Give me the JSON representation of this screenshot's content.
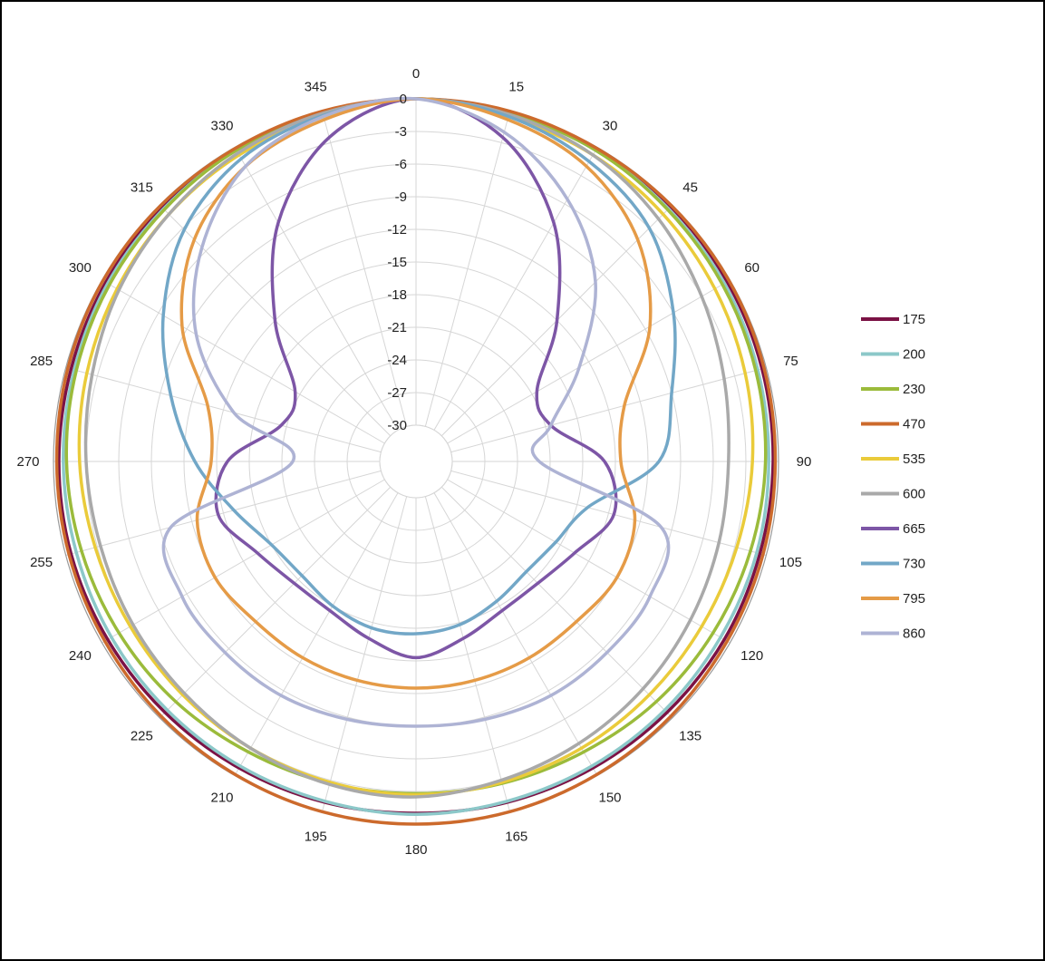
{
  "chart_data": {
    "type": "line",
    "subtype": "polar",
    "title": "",
    "angular_axis": {
      "unit": "degrees",
      "direction": "clockwise",
      "zero_at": "top",
      "tick_labels": [
        "0",
        "15",
        "30",
        "45",
        "60",
        "75",
        "90",
        "105",
        "120",
        "135",
        "150",
        "165",
        "180",
        "195",
        "210",
        "225",
        "240",
        "255",
        "270",
        "285",
        "300",
        "315",
        "330",
        "345"
      ]
    },
    "radial_axis": {
      "range": [
        -30,
        0
      ],
      "tick_labels": [
        "0",
        "-3",
        "-6",
        "-9",
        "-12",
        "-15",
        "-18",
        "-21",
        "-24",
        "-27",
        "-30"
      ]
    },
    "grid": true,
    "legend_position": "right",
    "angles": [
      0,
      15,
      30,
      45,
      60,
      75,
      90,
      105,
      120,
      135,
      150,
      165,
      180,
      195,
      210,
      225,
      240,
      255,
      270,
      285,
      300,
      315,
      330,
      345
    ],
    "series": [
      {
        "name": "175",
        "color": "#7B1245",
        "values": [
          0,
          -0.1,
          -0.1,
          -0.2,
          -0.3,
          -0.4,
          -0.5,
          -0.6,
          -0.6,
          -0.7,
          -0.8,
          -0.9,
          -1.0,
          -0.9,
          -0.8,
          -0.7,
          -0.6,
          -0.5,
          -0.5,
          -0.5,
          -0.4,
          -0.3,
          -0.2,
          -0.1
        ]
      },
      {
        "name": "200",
        "color": "#8CC8C9",
        "values": [
          0,
          -0.2,
          -0.3,
          -0.5,
          -0.6,
          -0.8,
          -0.9,
          -0.9,
          -1.0,
          -1.0,
          -1.0,
          -1.0,
          -0.9,
          -1.0,
          -1.0,
          -1.0,
          -1.0,
          -1.0,
          -0.9,
          -0.8,
          -0.6,
          -0.5,
          -0.3,
          -0.2
        ]
      },
      {
        "name": "230",
        "color": "#9BBB3B",
        "values": [
          0,
          -0.2,
          -0.3,
          -0.6,
          -0.8,
          -1.0,
          -1.2,
          -1.5,
          -1.8,
          -2.1,
          -2.5,
          -2.7,
          -2.8,
          -2.7,
          -2.5,
          -2.1,
          -1.8,
          -1.5,
          -1.2,
          -1.0,
          -0.8,
          -0.6,
          -0.3,
          -0.2
        ]
      },
      {
        "name": "470",
        "color": "#CC6A2C",
        "values": [
          0,
          0,
          -0.1,
          -0.1,
          -0.1,
          -0.2,
          -0.3,
          -0.3,
          -0.3,
          -0.2,
          -0.1,
          0,
          0,
          0,
          -0.1,
          -0.2,
          -0.3,
          -0.3,
          -0.3,
          -0.2,
          -0.1,
          -0.1,
          -0.1,
          0
        ]
      },
      {
        "name": "535",
        "color": "#EACB3A",
        "values": [
          0,
          -0.5,
          -0.8,
          -1.2,
          -1.6,
          -2.0,
          -2.4,
          -2.8,
          -3.0,
          -3.0,
          -2.9,
          -2.8,
          -2.7,
          -2.8,
          -2.9,
          -3.0,
          -3.0,
          -2.8,
          -2.4,
          -2.0,
          -1.6,
          -1.2,
          -0.8,
          -0.5
        ]
      },
      {
        "name": "600",
        "color": "#A9A9A9",
        "values": [
          0,
          -0.3,
          -0.8,
          -1.8,
          -3.0,
          -4.0,
          -4.6,
          -4.5,
          -4.2,
          -3.8,
          -3.4,
          -3.0,
          -2.5,
          -2.6,
          -2.9,
          -3.2,
          -3.3,
          -3.3,
          -3.0,
          -2.5,
          -1.8,
          -1.2,
          -0.6,
          -0.2
        ]
      },
      {
        "name": "665",
        "color": "#7D56A6",
        "values": [
          0,
          -2.5,
          -8.0,
          -15.0,
          -20.5,
          -20.5,
          -16.0,
          -14.5,
          -16.5,
          -17.5,
          -17.5,
          -16.5,
          -15.3,
          -16.5,
          -17.5,
          -17.5,
          -16.5,
          -14.5,
          -16.0,
          -20.5,
          -20.5,
          -15.0,
          -8.0,
          -2.5
        ]
      },
      {
        "name": "730",
        "color": "#72A7C7",
        "values": [
          0,
          -0.5,
          -1.5,
          -3.0,
          -6.0,
          -9.0,
          -11.0,
          -17.0,
          -18.5,
          -19.0,
          -18.5,
          -17.8,
          -17.5,
          -17.5,
          -18.0,
          -18.5,
          -18.0,
          -16.0,
          -13.0,
          -10.0,
          -6.5,
          -3.2,
          -1.2,
          -0.4
        ]
      },
      {
        "name": "795",
        "color": "#E59B47",
        "values": [
          0,
          -0.8,
          -2.0,
          -4.5,
          -8.5,
          -13.5,
          -14.5,
          -12.5,
          -12.0,
          -12.5,
          -12.5,
          -12.5,
          -12.5,
          -12.5,
          -12.5,
          -12.5,
          -12.0,
          -12.5,
          -14.5,
          -13.5,
          -8.5,
          -4.5,
          -2.0,
          -0.8
        ]
      },
      {
        "name": "860",
        "color": "#AEB3D4",
        "values": [
          0,
          -2.0,
          -5.5,
          -10.0,
          -16.0,
          -20.5,
          -22.0,
          -10.0,
          -8.5,
          -8.5,
          -8.5,
          -8.8,
          -9.0,
          -8.8,
          -8.5,
          -8.5,
          -8.5,
          -10.0,
          -22.0,
          -16.0,
          -10.0,
          -5.5,
          -2.0,
          -0.5
        ]
      }
    ]
  }
}
